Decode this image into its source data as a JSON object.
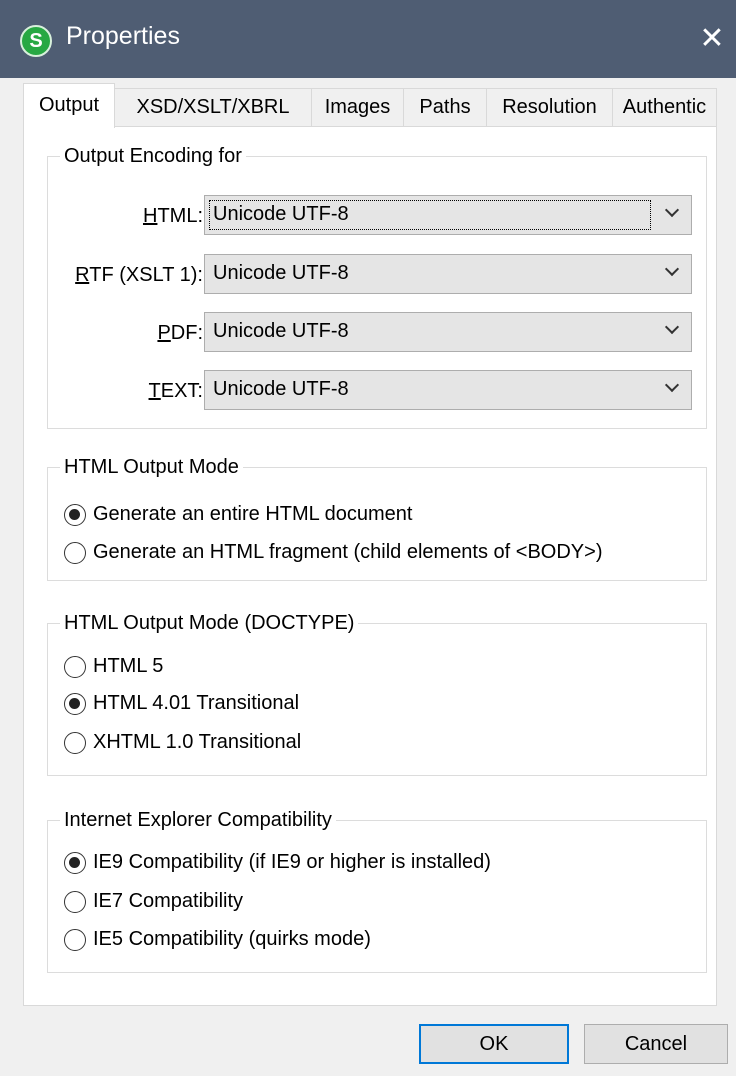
{
  "window": {
    "title": "Properties",
    "app_icon_glyph": "S",
    "close_glyph": "✕"
  },
  "tabs": [
    {
      "label": "Output",
      "active": true
    },
    {
      "label": "XSD/XSLT/XBRL"
    },
    {
      "label": "Images"
    },
    {
      "label": "Paths"
    },
    {
      "label": "Resolution"
    },
    {
      "label": "Authentic"
    }
  ],
  "encoding": {
    "legend": "Output Encoding for",
    "rows": [
      {
        "label_u": "H",
        "label_rest": "TML:",
        "value": "Unicode UTF-8"
      },
      {
        "label_u": "R",
        "label_rest": "TF (XSLT 1):",
        "value": "Unicode UTF-8"
      },
      {
        "label_u": "P",
        "label_rest": "DF:",
        "value": "Unicode UTF-8"
      },
      {
        "label_u": "T",
        "label_rest": "EXT:",
        "value": "Unicode UTF-8"
      }
    ]
  },
  "output_mode": {
    "legend": "HTML Output Mode",
    "options": [
      {
        "label": "Generate an entire HTML document",
        "checked": true
      },
      {
        "label": "Generate an HTML fragment (child elements of <BODY>)",
        "checked": false
      }
    ]
  },
  "doctype": {
    "legend": "HTML Output Mode (DOCTYPE)",
    "options": [
      {
        "label": "HTML 5",
        "checked": false
      },
      {
        "label": "HTML 4.01 Transitional",
        "checked": true
      },
      {
        "label": "XHTML 1.0 Transitional",
        "checked": false
      }
    ]
  },
  "ie": {
    "legend": "Internet Explorer Compatibility",
    "options": [
      {
        "label": "IE9 Compatibility (if IE9 or higher is installed)",
        "checked": true
      },
      {
        "label": "IE7 Compatibility",
        "checked": false
      },
      {
        "label": "IE5 Compatibility (quirks mode)",
        "checked": false
      }
    ]
  },
  "buttons": {
    "ok": "OK",
    "cancel": "Cancel"
  },
  "colors": {
    "titlebar": "#4f5d73",
    "accent": "#0078d7"
  }
}
